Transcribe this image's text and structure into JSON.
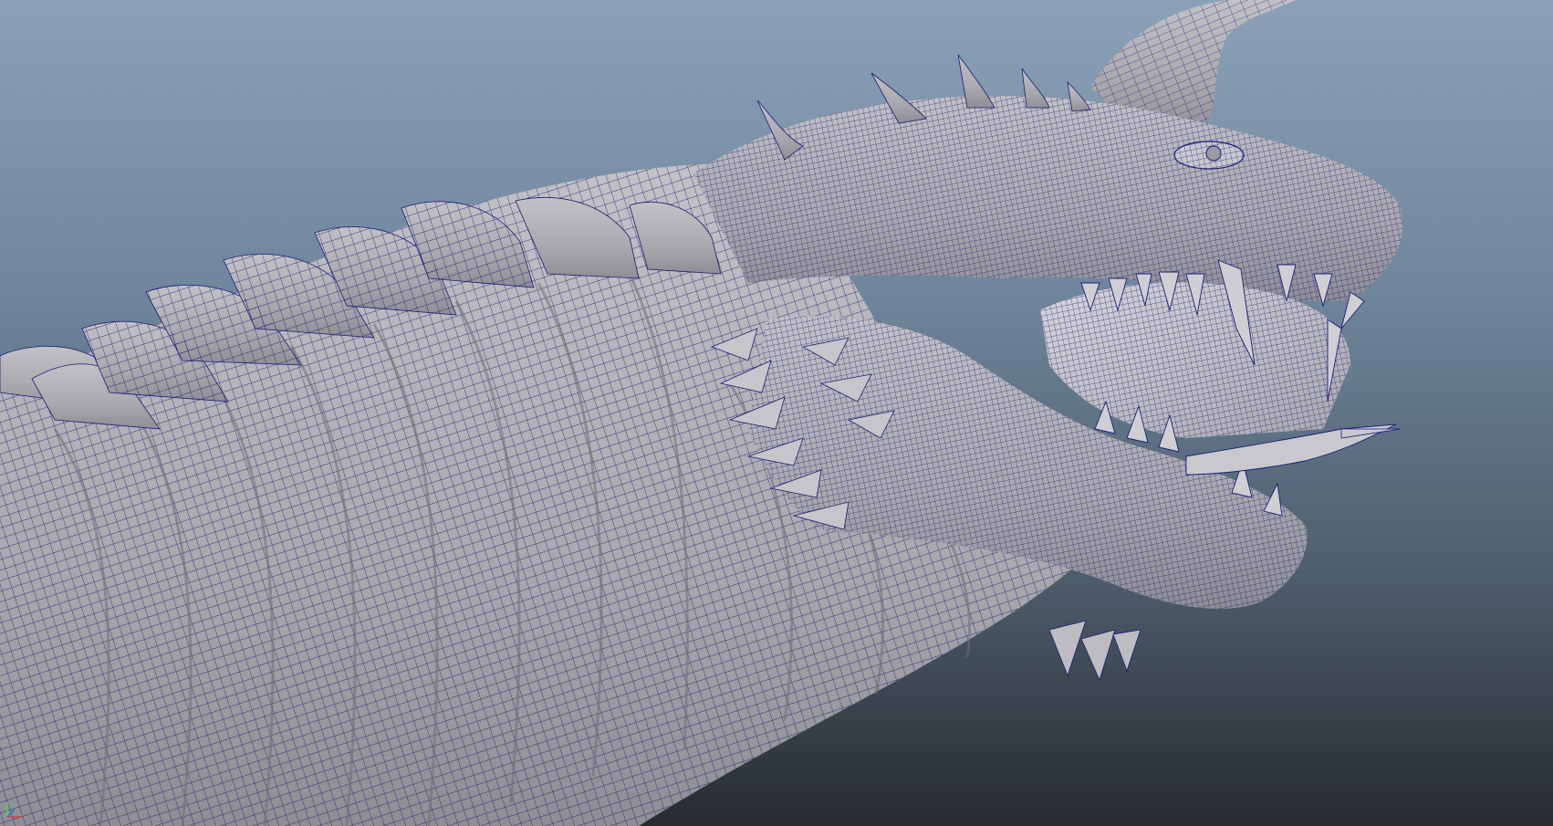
{
  "viewport": {
    "background_top": "#8aa1b8",
    "background_bottom": "#262b30",
    "mesh_surface_color": "#b3b3b8",
    "wireframe_color": "#1c1a7a",
    "shading_mode": "wireframe-on-shaded",
    "subject": "dragon-head-mesh"
  },
  "axis_gizmo": {
    "x_color": "#d83a3a",
    "y_color": "#4ad84a",
    "z_color": "#3a6ad8"
  }
}
